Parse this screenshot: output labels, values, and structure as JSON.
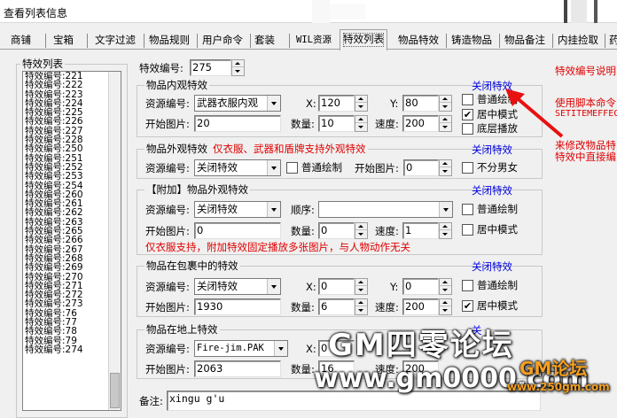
{
  "window": {
    "title": "查看列表信息"
  },
  "tabs": [
    "商铺",
    "宝箱",
    "文字过滤",
    "物品规则",
    "用户命令",
    "套装",
    "WIL资源",
    "特效列表",
    "物品特效",
    "铸造物品",
    "物品备注",
    "内挂捡取",
    "药"
  ],
  "active_tab": "特效列表",
  "effect_list": {
    "title": "特效列表",
    "items": [
      "特效编号:221",
      "特效编号:222",
      "特效编号:223",
      "特效编号:224",
      "特效编号:225",
      "特效编号:226",
      "特效编号:227",
      "特效编号:228",
      "特效编号:250",
      "特效编号:251",
      "特效编号:252",
      "特效编号:253",
      "特效编号:254",
      "特效编号:260",
      "特效编号:261",
      "特效编号:262",
      "特效编号:263",
      "特效编号:265",
      "特效编号:266",
      "特效编号:267",
      "特效编号:268",
      "特效编号:269",
      "特效编号:270",
      "特效编号:271",
      "特效编号:272",
      "特效编号:273",
      "特效编号:76",
      "特效编号:77",
      "特效编号:78",
      "特效编号:79",
      "特效编号:274"
    ]
  },
  "effect_id": {
    "label": "特效编号:",
    "value": "275"
  },
  "inner": {
    "title": "物品内观特效",
    "close_link": "关闭特效",
    "res_label": "资源编号:",
    "res_value": "武器衣服内观",
    "x_label": "X:",
    "x_value": "120",
    "y_label": "Y:",
    "y_value": "80",
    "normal_draw": "普通绘制",
    "center_mode": "居中模式",
    "bottom_play": "底层播放",
    "start_label": "开始图片:",
    "start_value": "20",
    "count_label": "数量:",
    "count_value": "10",
    "speed_label": "速度:",
    "speed_value": "200"
  },
  "outer": {
    "title": "物品外观特效",
    "note": "仅衣服、武器和盾牌支持外观特效",
    "close_link": "关闭特效",
    "res_label": "资源编号:",
    "res_value": "关闭特效",
    "normal_draw": "普通绘制",
    "start_label": "开始图片:",
    "start_value": "0",
    "gender": "不分男女"
  },
  "attached": {
    "title": "【附加】物品外观特效",
    "close_link": "关闭特效",
    "res_label": "资源编号:",
    "res_value": "关闭特效",
    "order_label": "顺序:",
    "order_value": "",
    "normal_draw": "普通绘制",
    "start_label": "开始图片:",
    "start_value": "0",
    "count_label": "数量:",
    "count_value": "0",
    "speed_label": "速度:",
    "speed_value": "1",
    "center_mode": "居中模式",
    "note": "仅衣服支持，附加特效固定播放多张图片，与人物动作无关"
  },
  "bag": {
    "title": "物品在包裹中的特效",
    "close_link": "关闭特效",
    "res_label": "资源编号:",
    "res_value": "关闭特效",
    "x_label": "X:",
    "x_value": "0",
    "y_label": "Y:",
    "y_value": "0",
    "normal_draw": "普通绘制",
    "start_label": "开始图片:",
    "start_value": "1930",
    "count_label": "数量:",
    "count_value": "6",
    "speed_label": "速度:",
    "speed_value": "200",
    "center_mode": "居中模式"
  },
  "ground": {
    "title": "物品在地上特效",
    "close_link": "关",
    "res_label": "资源编号:",
    "res_value": "Fire-jim.PAK",
    "x_label": "X:",
    "x_value": "0",
    "start_label": "开始图片:",
    "start_value": "2063",
    "count_label": "数量:",
    "count_value": "16",
    "speed_label": "速度:",
    "speed_value": "200"
  },
  "remark": {
    "label": "备注:",
    "value": "xingu    g'u"
  },
  "right_notes": {
    "note1": "特效编号说明",
    "note2a": "使用脚本命令",
    "note2b": "SETITEMEFFEC",
    "note3a": "来修改物品特",
    "note3b": "特效中直接编"
  },
  "watermark": {
    "line1": "GM四零论坛",
    "line2": "www.gm0000.com",
    "line3": "www.250gm.com",
    "logo_text": "GM论坛"
  },
  "colors": {
    "accent_blue": "#0000e0",
    "note_red": "#e00000",
    "arrow_red": "#e81010"
  }
}
